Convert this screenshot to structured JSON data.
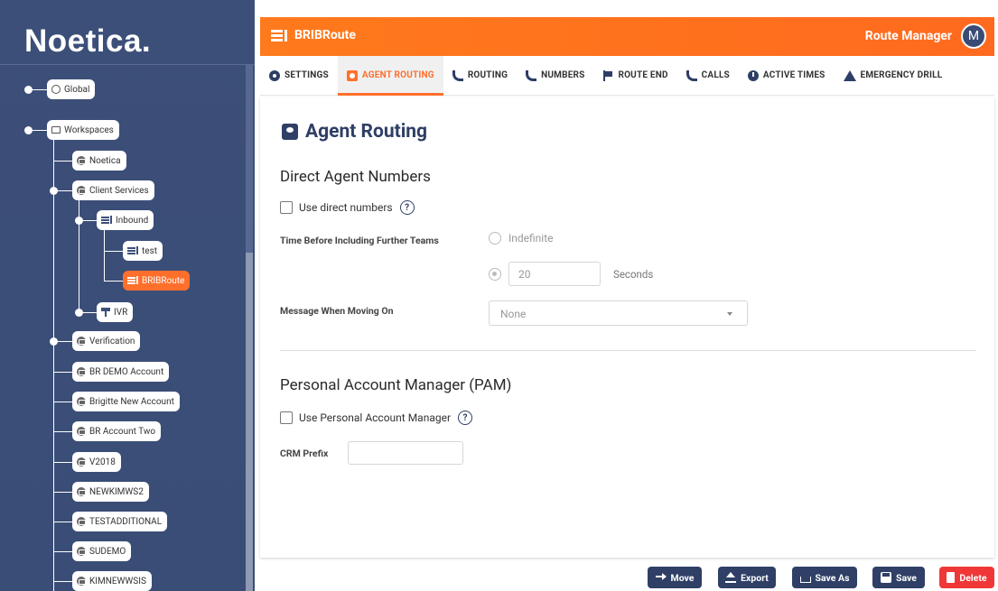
{
  "brand": {
    "logo_text": "Noetica."
  },
  "tree": {
    "global": "Global",
    "workspaces": "Workspaces",
    "noetica": "Noetica",
    "client_services": "Client Services",
    "inbound": "Inbound",
    "test": "test",
    "bribroute": "BRIBRoute",
    "ivr": "IVR",
    "verification": "Verification",
    "br_demo_account": "BR DEMO Account",
    "brigitte_new_account": "Brigitte New Account",
    "br_account_two": "BR Account Two",
    "v2018": "V2018",
    "newkimws2": "NEWKIMWS2",
    "testadditional": "TESTADDITIONAL",
    "sudemo": "SUDEMO",
    "kimnewwsis": "KIMNEWWSIS"
  },
  "header": {
    "title": "BRIBRoute",
    "role": "Route Manager",
    "avatar_initial": "M",
    "accent_color": "#ff6f2c"
  },
  "tabs": [
    {
      "label": "SETTINGS",
      "icon": "gear-icon"
    },
    {
      "label": "AGENT ROUTING",
      "icon": "account-box-icon",
      "active": true
    },
    {
      "label": "ROUTING",
      "icon": "phone-forward-icon"
    },
    {
      "label": "NUMBERS",
      "icon": "phone-in-talk-icon"
    },
    {
      "label": "ROUTE END",
      "icon": "flag-icon"
    },
    {
      "label": "CALLS",
      "icon": "phone-icon"
    },
    {
      "label": "ACTIVE TIMES",
      "icon": "clock-icon"
    },
    {
      "label": "EMERGENCY DRILL",
      "icon": "warning-icon"
    }
  ],
  "main": {
    "page_title": "Agent Routing",
    "direct_section": "Direct Agent Numbers",
    "use_direct_label": "Use direct numbers",
    "time_label": "Time Before Including Further Teams",
    "indefinite_label": "Indefinite",
    "seconds_value": "20",
    "seconds_label": "Seconds",
    "message_label": "Message When Moving On",
    "message_value": "None",
    "pam_section": "Personal Account Manager (PAM)",
    "use_pam_label": "Use Personal Account Manager",
    "crm_prefix_label": "CRM Prefix",
    "crm_prefix_value": ""
  },
  "footer": {
    "move": "Move",
    "export": "Export",
    "save_as": "Save As",
    "save": "Save",
    "delete": "Delete"
  }
}
